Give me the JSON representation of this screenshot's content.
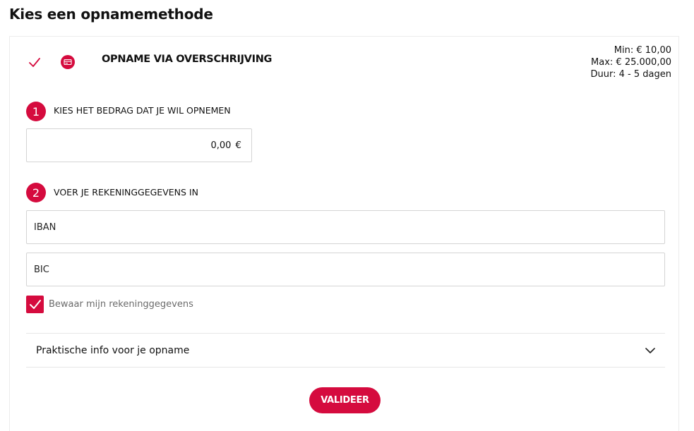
{
  "page": {
    "title": "Kies een opnamemethode"
  },
  "method": {
    "title": "OPNAME VIA OVERSCHRIJVING",
    "icon": "bank-card-icon",
    "selected_icon": "checkmark-icon",
    "limits": {
      "min": "Min: € 10,00",
      "max": "Max: € 25.000,00",
      "duration": "Duur: 4 - 5 dagen"
    }
  },
  "step1": {
    "number": "1",
    "label": "KIES HET BEDRAG DAT JE WIL OPNEMEN",
    "amount_value": "0,00",
    "currency": "€"
  },
  "step2": {
    "number": "2",
    "label": "VOER JE REKENINGGEGEVENS IN",
    "iban_placeholder": "IBAN",
    "bic_placeholder": "BIC",
    "save_label": "Bewaar mijn rekeninggegevens",
    "save_checked": true
  },
  "info": {
    "label": "Praktische info voor je opname",
    "icon": "chevron-down-icon"
  },
  "actions": {
    "validate_label": "VALIDEER"
  },
  "colors": {
    "accent": "#d50b3e",
    "border": "#d4d4d4",
    "muted_text": "#6b6b6b"
  }
}
